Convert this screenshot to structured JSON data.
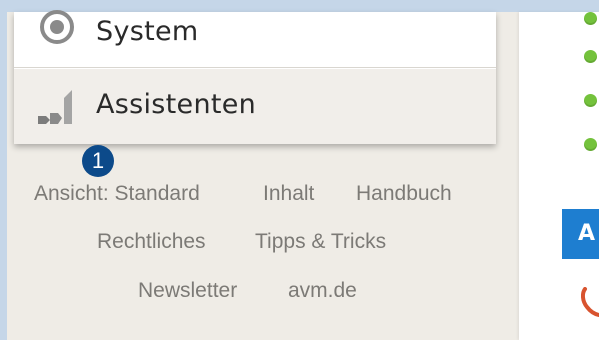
{
  "menu": {
    "items": [
      {
        "label": "System",
        "icon": "system-icon"
      },
      {
        "label": "Assistenten",
        "icon": "wizard-icon"
      }
    ]
  },
  "annotation": {
    "badge": "1"
  },
  "footer": {
    "links": [
      {
        "label": "Ansicht: Standard"
      },
      {
        "label": "Inhalt"
      },
      {
        "label": "Handbuch"
      },
      {
        "label": "Rechtliches"
      },
      {
        "label": "Tipps & Tricks"
      },
      {
        "label": "Newsletter"
      },
      {
        "label": "avm.de"
      }
    ]
  },
  "content": {
    "status_dot_color": "#74c23c",
    "section_letter": "A",
    "section_color": "#1e7ed0",
    "phone_icon": "phone-icon"
  }
}
